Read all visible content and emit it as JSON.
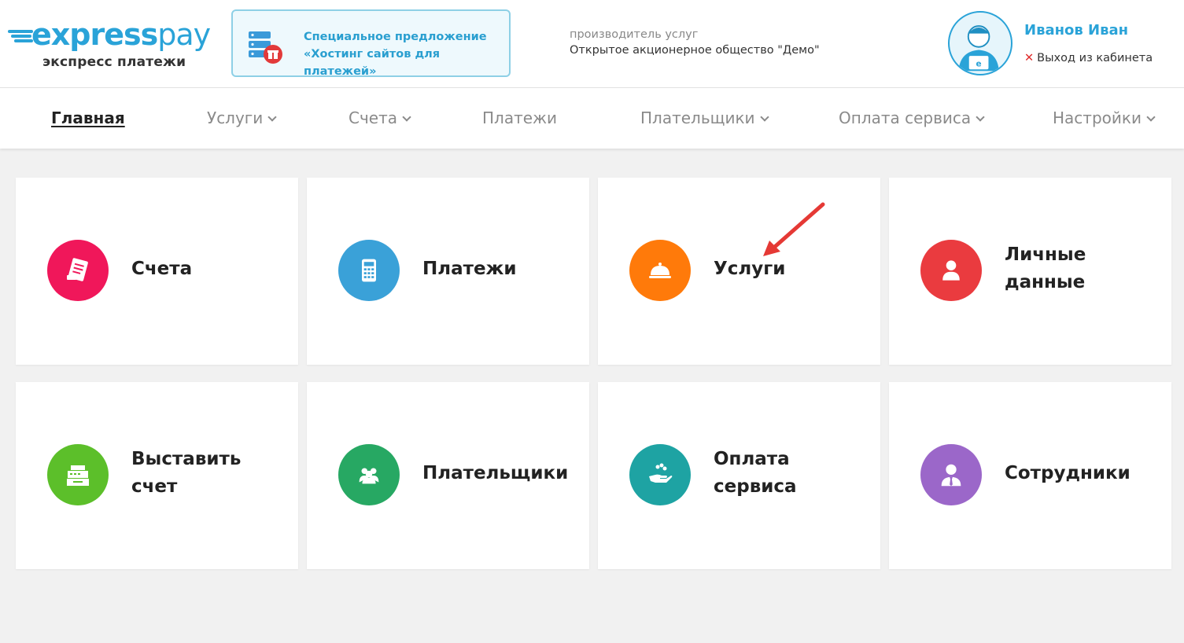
{
  "header": {
    "logo_express": "express",
    "logo_pay": "pay",
    "logo_subtitle": "экспресс платежи",
    "promo_line1": "Специальное предложение",
    "promo_line2": "«Хостинг сайтов для платежей»",
    "provider_label": "производитель услуг",
    "provider_name": "Открытое акционерное общество \"Демо\"",
    "user_name": "Иванов Иван",
    "logout_label": "Выход из кабинета"
  },
  "nav": {
    "items": [
      {
        "label": "Главная",
        "active": true,
        "dropdown": false
      },
      {
        "label": "Услуги",
        "dropdown": true
      },
      {
        "label": "Счета",
        "dropdown": true
      },
      {
        "label": "Платежи",
        "dropdown": false
      },
      {
        "label": "Плательщики",
        "dropdown": true
      },
      {
        "label": "Оплата сервиса",
        "dropdown": true
      },
      {
        "label": "Настройки",
        "dropdown": true
      }
    ]
  },
  "tiles": [
    {
      "label_line1": "Счета",
      "label_line2": "",
      "color": "#f0175a",
      "icon": "invoice-icon"
    },
    {
      "label_line1": "Платежи",
      "label_line2": "",
      "color": "#3aa1d8",
      "icon": "calculator-icon"
    },
    {
      "label_line1": "Услуги",
      "label_line2": "",
      "color": "#ff7a0a",
      "icon": "cloche-icon"
    },
    {
      "label_line1": "Личные",
      "label_line2": "данные",
      "color": "#ea3b3f",
      "icon": "person-icon"
    },
    {
      "label_line1": "Выставить",
      "label_line2": "счет",
      "color": "#5cbf2a",
      "icon": "cash-register-icon"
    },
    {
      "label_line1": "Плательщики",
      "label_line2": "",
      "color": "#27a863",
      "icon": "users-icon"
    },
    {
      "label_line1": "Оплата",
      "label_line2": "сервиса",
      "color": "#1ea3a3",
      "icon": "hand-coins-icon"
    },
    {
      "label_line1": "Сотрудники",
      "label_line2": "",
      "color": "#9b67c9",
      "icon": "employee-icon"
    }
  ],
  "colors": {
    "brand": "#2aa3d8",
    "logout_x": "#e02a2a",
    "annotation_arrow": "#e53935"
  }
}
